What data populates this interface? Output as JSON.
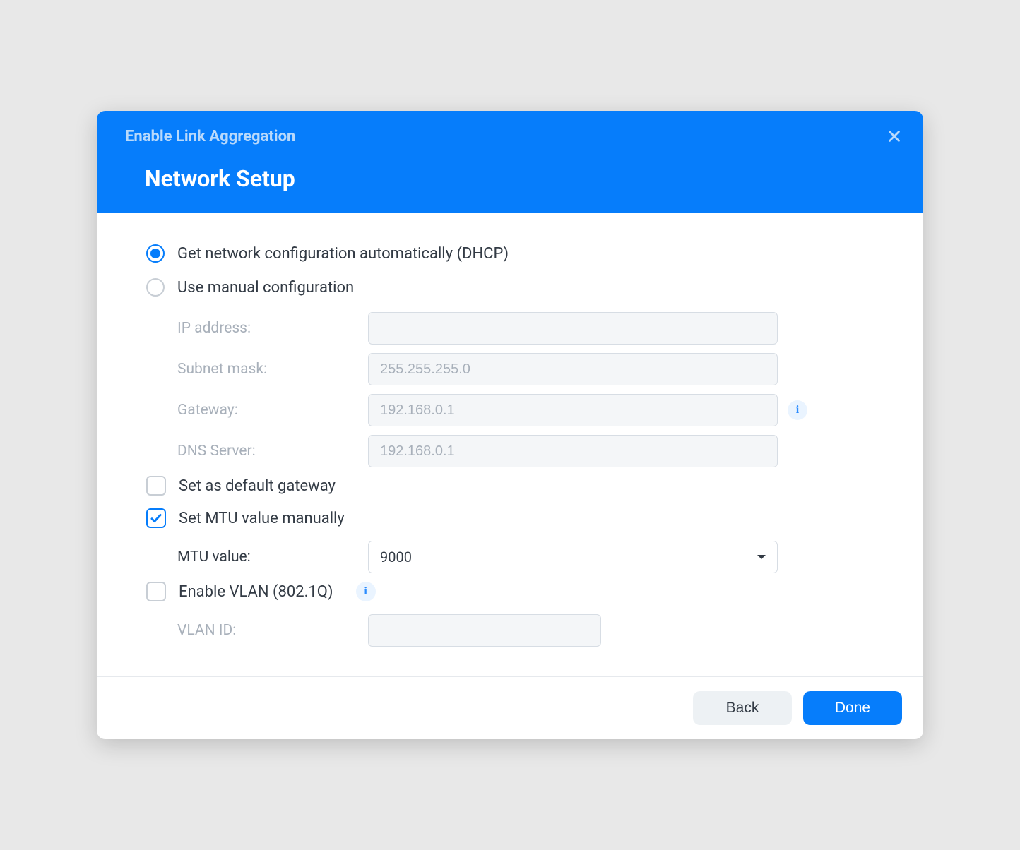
{
  "header": {
    "wizard_title": "Enable Link Aggregation",
    "page_title": "Network Setup"
  },
  "radio": {
    "dhcp_label": "Get network configuration automatically (DHCP)",
    "manual_label": "Use manual configuration",
    "selected": "dhcp"
  },
  "fields": {
    "ip_label": "IP address:",
    "ip_value": "",
    "subnet_label": "Subnet mask:",
    "subnet_value": "255.255.255.0",
    "gateway_label": "Gateway:",
    "gateway_value": "192.168.0.1",
    "dns_label": "DNS Server:",
    "dns_value": "192.168.0.1"
  },
  "checks": {
    "default_gateway_label": "Set as default gateway",
    "default_gateway_checked": false,
    "mtu_manual_label": "Set MTU value manually",
    "mtu_manual_checked": true,
    "mtu_value_label": "MTU value:",
    "mtu_value": "9000",
    "vlan_label": "Enable VLAN (802.1Q)",
    "vlan_checked": false,
    "vlan_id_label": "VLAN ID:",
    "vlan_id_value": ""
  },
  "footer": {
    "back_label": "Back",
    "done_label": "Done"
  }
}
